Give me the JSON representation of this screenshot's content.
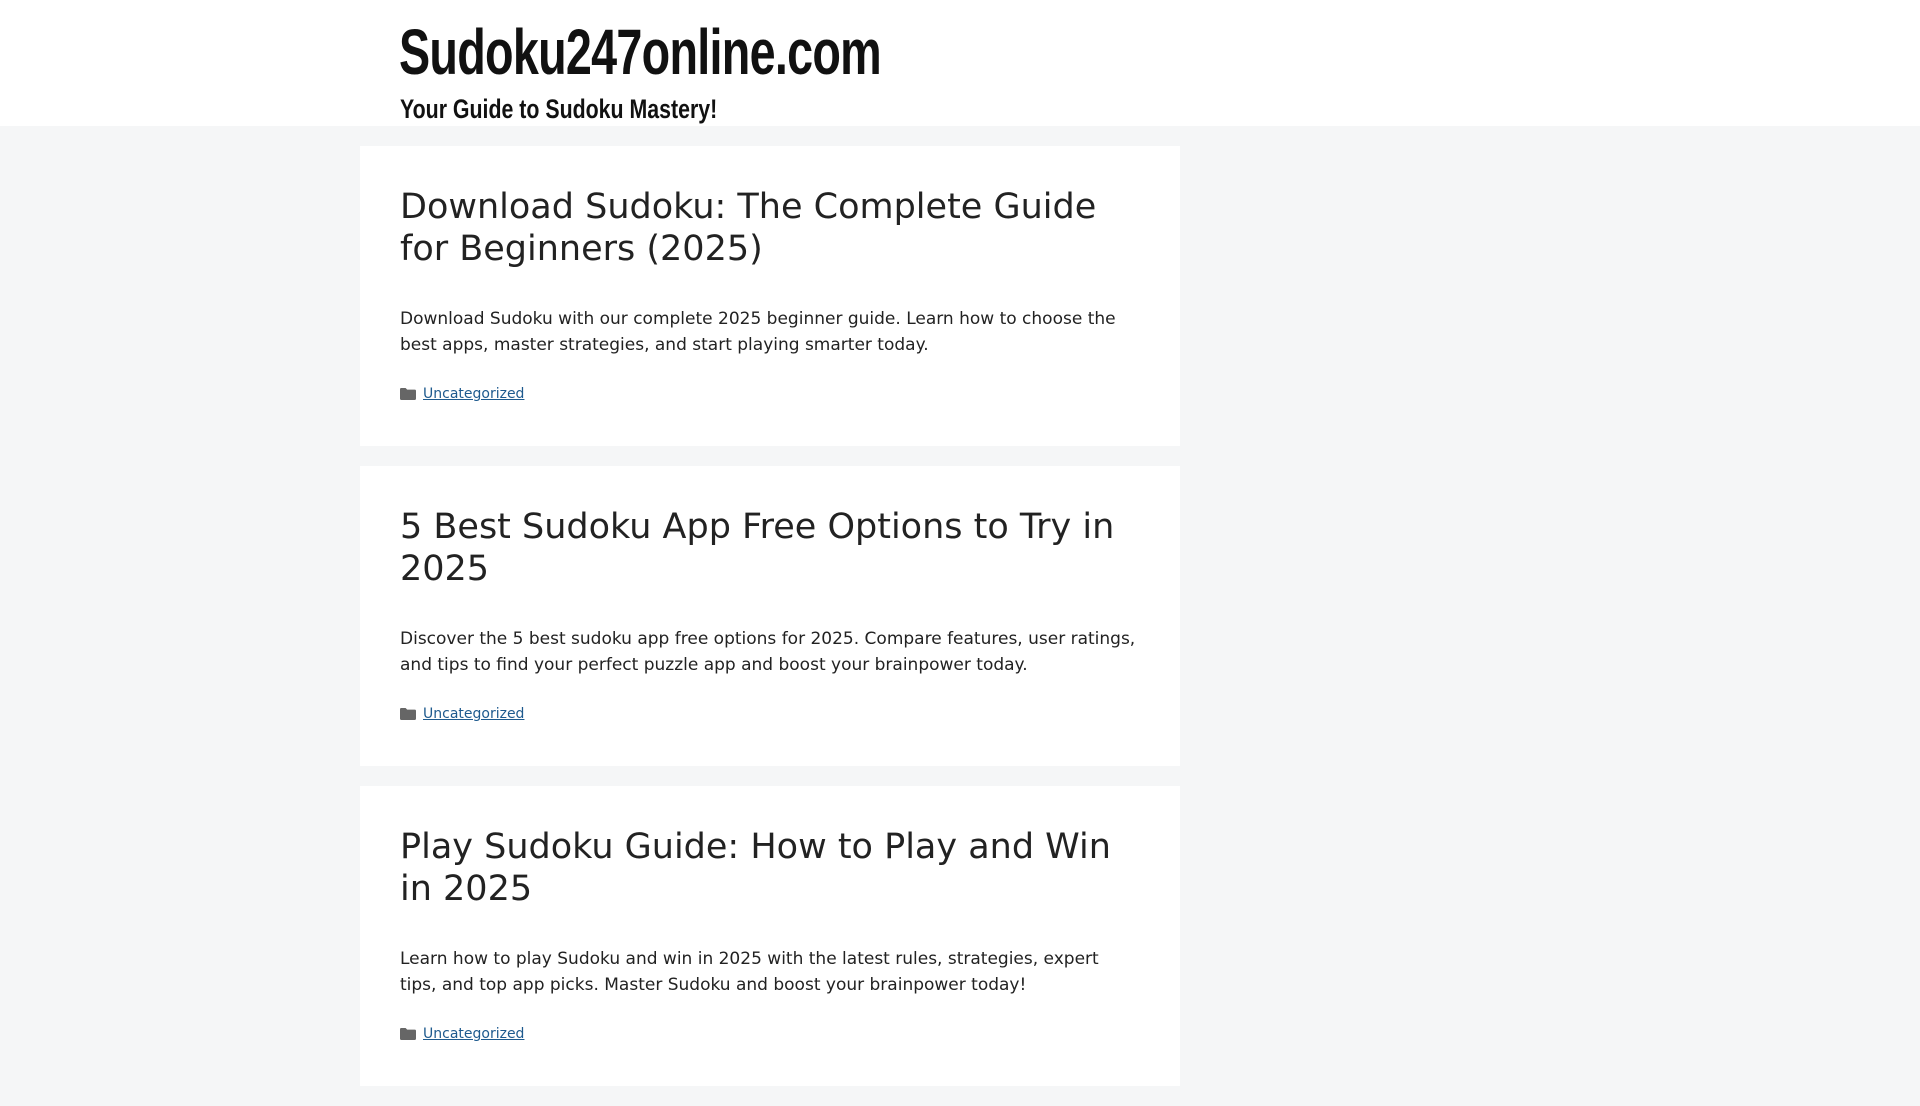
{
  "header": {
    "site_title": "Sudoku247online.com",
    "tagline": "Your Guide to Sudoku Mastery!"
  },
  "posts": [
    {
      "title": "Download Sudoku: The Complete Guide for Beginners (2025)",
      "excerpt": "Download Sudoku with our complete 2025 beginner guide. Learn how to choose the best apps, master strategies, and start playing smarter today.",
      "category": "Uncategorized",
      "category_icon": "folder-icon"
    },
    {
      "title": "5 Best Sudoku App Free Options to Try in 2025",
      "excerpt": "Discover the 5 best sudoku app free options for 2025. Compare features, user ratings, and tips to find your perfect puzzle app and boost your brainpower today.",
      "category": "Uncategorized",
      "category_icon": "folder-icon"
    },
    {
      "title": "Play Sudoku Guide: How to Play and Win in 2025",
      "excerpt": "Learn how to play Sudoku and win in 2025 with the latest rules, strategies, expert tips, and top app picks. Master Sudoku and boost your brainpower today!",
      "category": "Uncategorized",
      "category_icon": "folder-icon"
    }
  ],
  "colors": {
    "page_background": "#f5f6f7",
    "card_background": "#ffffff",
    "link": "#1e5a8e",
    "text": "#222222",
    "icon": "#666666"
  }
}
